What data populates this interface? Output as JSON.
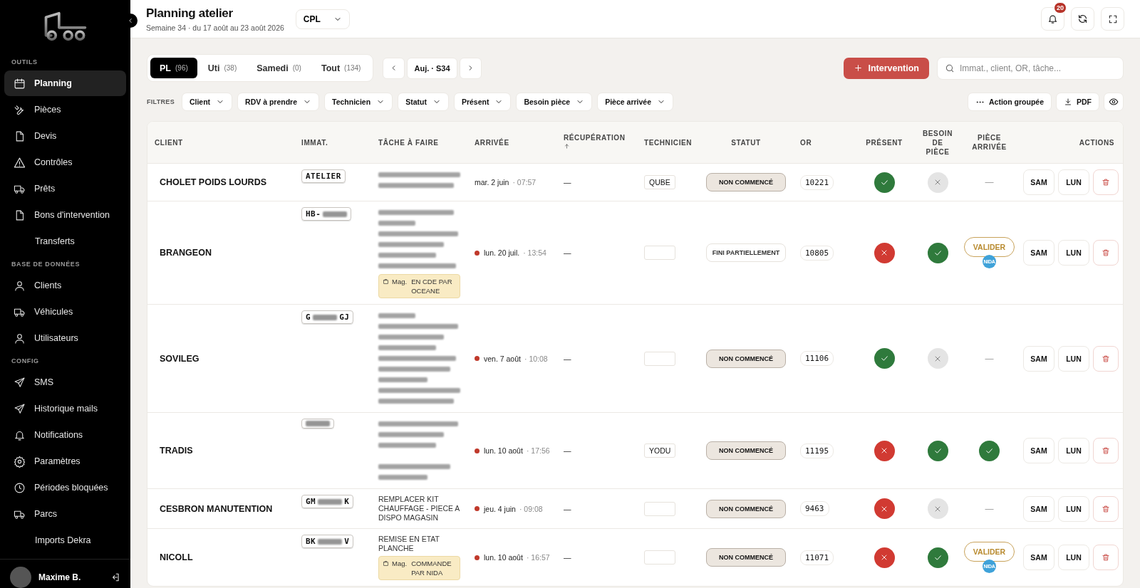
{
  "sidebar": {
    "sections": [
      {
        "title": "OUTILS",
        "items": [
          {
            "label": "Planning",
            "kind": "calendar",
            "selected": true
          },
          {
            "label": "Pièces",
            "kind": "wrench",
            "selected": false
          },
          {
            "label": "Devis",
            "kind": "file",
            "selected": false
          },
          {
            "label": "Contrôles",
            "kind": "warning",
            "selected": false
          },
          {
            "label": "Prêts",
            "kind": "truck",
            "selected": false
          },
          {
            "label": "Bons d'intervention",
            "kind": "file",
            "selected": false
          },
          {
            "label": "Transferts",
            "kind": "plain",
            "selected": false
          }
        ]
      },
      {
        "title": "BASE DE DONNÉES",
        "items": [
          {
            "label": "Clients",
            "kind": "user",
            "selected": false
          },
          {
            "label": "Véhicules",
            "kind": "truck",
            "selected": false
          },
          {
            "label": "Utilisateurs",
            "kind": "user",
            "selected": false
          }
        ]
      },
      {
        "title": "CONFIG",
        "items": [
          {
            "label": "SMS",
            "kind": "send",
            "selected": false
          },
          {
            "label": "Historique mails",
            "kind": "send",
            "selected": false
          },
          {
            "label": "Notifications",
            "kind": "bell",
            "selected": false
          },
          {
            "label": "Paramètres",
            "kind": "gear",
            "selected": false
          },
          {
            "label": "Périodes bloquées",
            "kind": "clock",
            "selected": false
          },
          {
            "label": "Parcs",
            "kind": "truck",
            "selected": false
          },
          {
            "label": "Imports Dekra",
            "kind": "plain",
            "selected": false
          }
        ]
      }
    ],
    "user": {
      "name": "Maxime B."
    }
  },
  "header": {
    "title": "Planning atelier",
    "subtitle": "Semaine 34 · du 17 août au 23 août 2026",
    "site": "CPL",
    "notification_count": "20"
  },
  "tabs": [
    {
      "label": "PL",
      "count": "(96)",
      "selected": true
    },
    {
      "label": "Uti",
      "count": "(38)",
      "selected": false
    },
    {
      "label": "Samedi",
      "count": "(0)",
      "selected": false
    },
    {
      "label": "Tout",
      "count": "(134)",
      "selected": false
    }
  ],
  "week_nav": {
    "label": "Auj. · S34"
  },
  "new_button": "Intervention",
  "search": {
    "placeholder": "Immat., client, OR, tâche..."
  },
  "filters": {
    "label": "FILTRES",
    "items": [
      "Client",
      "RDV à prendre",
      "Technicien",
      "Statut",
      "Présent",
      "Besoin pièce",
      "Pièce arrivée"
    ]
  },
  "actions": {
    "group": "Action groupée",
    "pdf": "PDF"
  },
  "table": {
    "columns": [
      {
        "label": "CLIENT",
        "sorted": false
      },
      {
        "label": "IMMAT.",
        "sorted": false
      },
      {
        "label": "TÂCHE À FAIRE",
        "sorted": false
      },
      {
        "label": "ARRIVÉE",
        "sorted": false
      },
      {
        "label": "RÉCUPÉRATION",
        "sorted": true
      },
      {
        "label": "TECHNICIEN",
        "sorted": false
      },
      {
        "label": "STATUT",
        "sorted": false
      },
      {
        "label": "OR",
        "sorted": false
      },
      {
        "label": "PRÉSENT",
        "sorted": false
      },
      {
        "label": "BESOIN DE PIÈCE",
        "sorted": false
      },
      {
        "label": "PIÈCE ARRIVÉE",
        "sorted": false
      },
      {
        "label": "ACTIONS",
        "sorted": false
      }
    ],
    "rows": [
      {
        "client": "CHOLET POIDS LOURDS",
        "plate": [
          {
            "kind": "text",
            "text": "ATELIER"
          }
        ],
        "task": {
          "lines": [
            {
              "kind": "blur"
            },
            {
              "kind": "blur"
            }
          ]
        },
        "arrival": {
          "date": "mar. 2 juin",
          "time": "· 07:57",
          "late": false
        },
        "pickup": "—",
        "technician": "QUBE",
        "status": {
          "label": "NON COMMENCÉ",
          "kind": "not_started"
        },
        "or": "10221",
        "present": true,
        "parts_needed": false,
        "part_arrived": {
          "kind": "none",
          "text": "—"
        },
        "actions": [
          "SAM",
          "LUN"
        ]
      },
      {
        "client": "BRANGEON",
        "plate": [
          {
            "kind": "text",
            "text": "HB-"
          },
          {
            "kind": "blur"
          }
        ],
        "task": {
          "lines": [
            {
              "kind": "blur"
            },
            {
              "kind": "blur"
            },
            {
              "kind": "blur"
            },
            {
              "kind": "blur"
            },
            {
              "kind": "blur"
            },
            {
              "kind": "blur"
            }
          ],
          "tag": {
            "label": "Mag.",
            "text": "EN CDE PAR OCEANE"
          }
        },
        "arrival": {
          "date": "lun. 20 juil.",
          "time": "· 13:54",
          "late": true
        },
        "pickup": "—",
        "status": {
          "label": "FINI PARTIELLEMENT",
          "kind": "partial"
        },
        "or": "10805",
        "present": false,
        "parts_needed": true,
        "part_arrived": {
          "kind": "validate",
          "text": "VALIDER",
          "by": "NIDA"
        },
        "actions": [
          "SAM",
          "LUN"
        ]
      },
      {
        "client": "SOVILEG",
        "plate": [
          {
            "kind": "text",
            "text": "G"
          },
          {
            "kind": "blur"
          },
          {
            "kind": "text",
            "text": "GJ"
          }
        ],
        "task": {
          "lines": [
            {
              "kind": "blur"
            },
            {
              "kind": "blur"
            },
            {
              "kind": "blur"
            },
            {
              "kind": "blur"
            },
            {
              "kind": "blur"
            },
            {
              "kind": "blur"
            },
            {
              "kind": "blur"
            },
            {
              "kind": "blur"
            },
            {
              "kind": "blur"
            }
          ]
        },
        "arrival": {
          "date": "ven. 7 août",
          "time": "· 10:08",
          "late": true
        },
        "pickup": "—",
        "status": {
          "label": "NON COMMENCÉ",
          "kind": "not_started"
        },
        "or": "11106",
        "present": true,
        "parts_needed": false,
        "part_arrived": {
          "kind": "none",
          "text": "—"
        },
        "actions": [
          "SAM",
          "LUN"
        ]
      },
      {
        "client": "TRADIS",
        "plate": [
          {
            "kind": "blur"
          }
        ],
        "task": {
          "lines": [
            {
              "kind": "blur"
            },
            {
              "kind": "blur"
            },
            {
              "kind": "blur"
            },
            {
              "kind": "gap"
            },
            {
              "kind": "blur"
            },
            {
              "kind": "blur"
            }
          ]
        },
        "arrival": {
          "date": "lun. 10 août",
          "time": "· 17:56",
          "late": true
        },
        "pickup": "—",
        "technician": "YODU",
        "status": {
          "label": "NON COMMENCÉ",
          "kind": "not_started"
        },
        "or": "11195",
        "present": false,
        "parts_needed": true,
        "part_arrived": {
          "kind": "done"
        },
        "actions": [
          "SAM",
          "LUN"
        ]
      },
      {
        "client": "CESBRON MANUTENTION",
        "plate": [
          {
            "kind": "text",
            "text": "GM"
          },
          {
            "kind": "blur"
          },
          {
            "kind": "text",
            "text": "K"
          }
        ],
        "task": {
          "lines": [
            {
              "kind": "text",
              "text": "REMPLACER KIT CHAUFFAGE - PIECE A DISPO MAGASIN"
            }
          ]
        },
        "arrival": {
          "date": "jeu. 4 juin",
          "time": "· 09:08",
          "late": true
        },
        "pickup": "—",
        "status": {
          "label": "NON COMMENCÉ",
          "kind": "not_started"
        },
        "or": "9463",
        "present": false,
        "parts_needed": false,
        "part_arrived": {
          "kind": "none",
          "text": "—"
        },
        "actions": [
          "SAM",
          "LUN"
        ]
      },
      {
        "client": "NICOLL",
        "plate": [
          {
            "kind": "text",
            "text": "BK"
          },
          {
            "kind": "blur"
          },
          {
            "kind": "text",
            "text": "V"
          }
        ],
        "task": {
          "lines": [
            {
              "kind": "text",
              "text": "REMISE EN ETAT PLANCHE"
            }
          ],
          "tag": {
            "label": "Mag.",
            "text": "COMMANDE PAR NIDA"
          }
        },
        "arrival": {
          "date": "lun. 10 août",
          "time": "· 16:57",
          "late": true
        },
        "pickup": "—",
        "status": {
          "label": "NON COMMENCÉ",
          "kind": "not_started"
        },
        "or": "11071",
        "present": false,
        "parts_needed": true,
        "part_arrived": {
          "kind": "validate",
          "text": "VALIDER",
          "by": "NIDA"
        },
        "actions": [
          "SAM",
          "LUN"
        ]
      }
    ]
  }
}
